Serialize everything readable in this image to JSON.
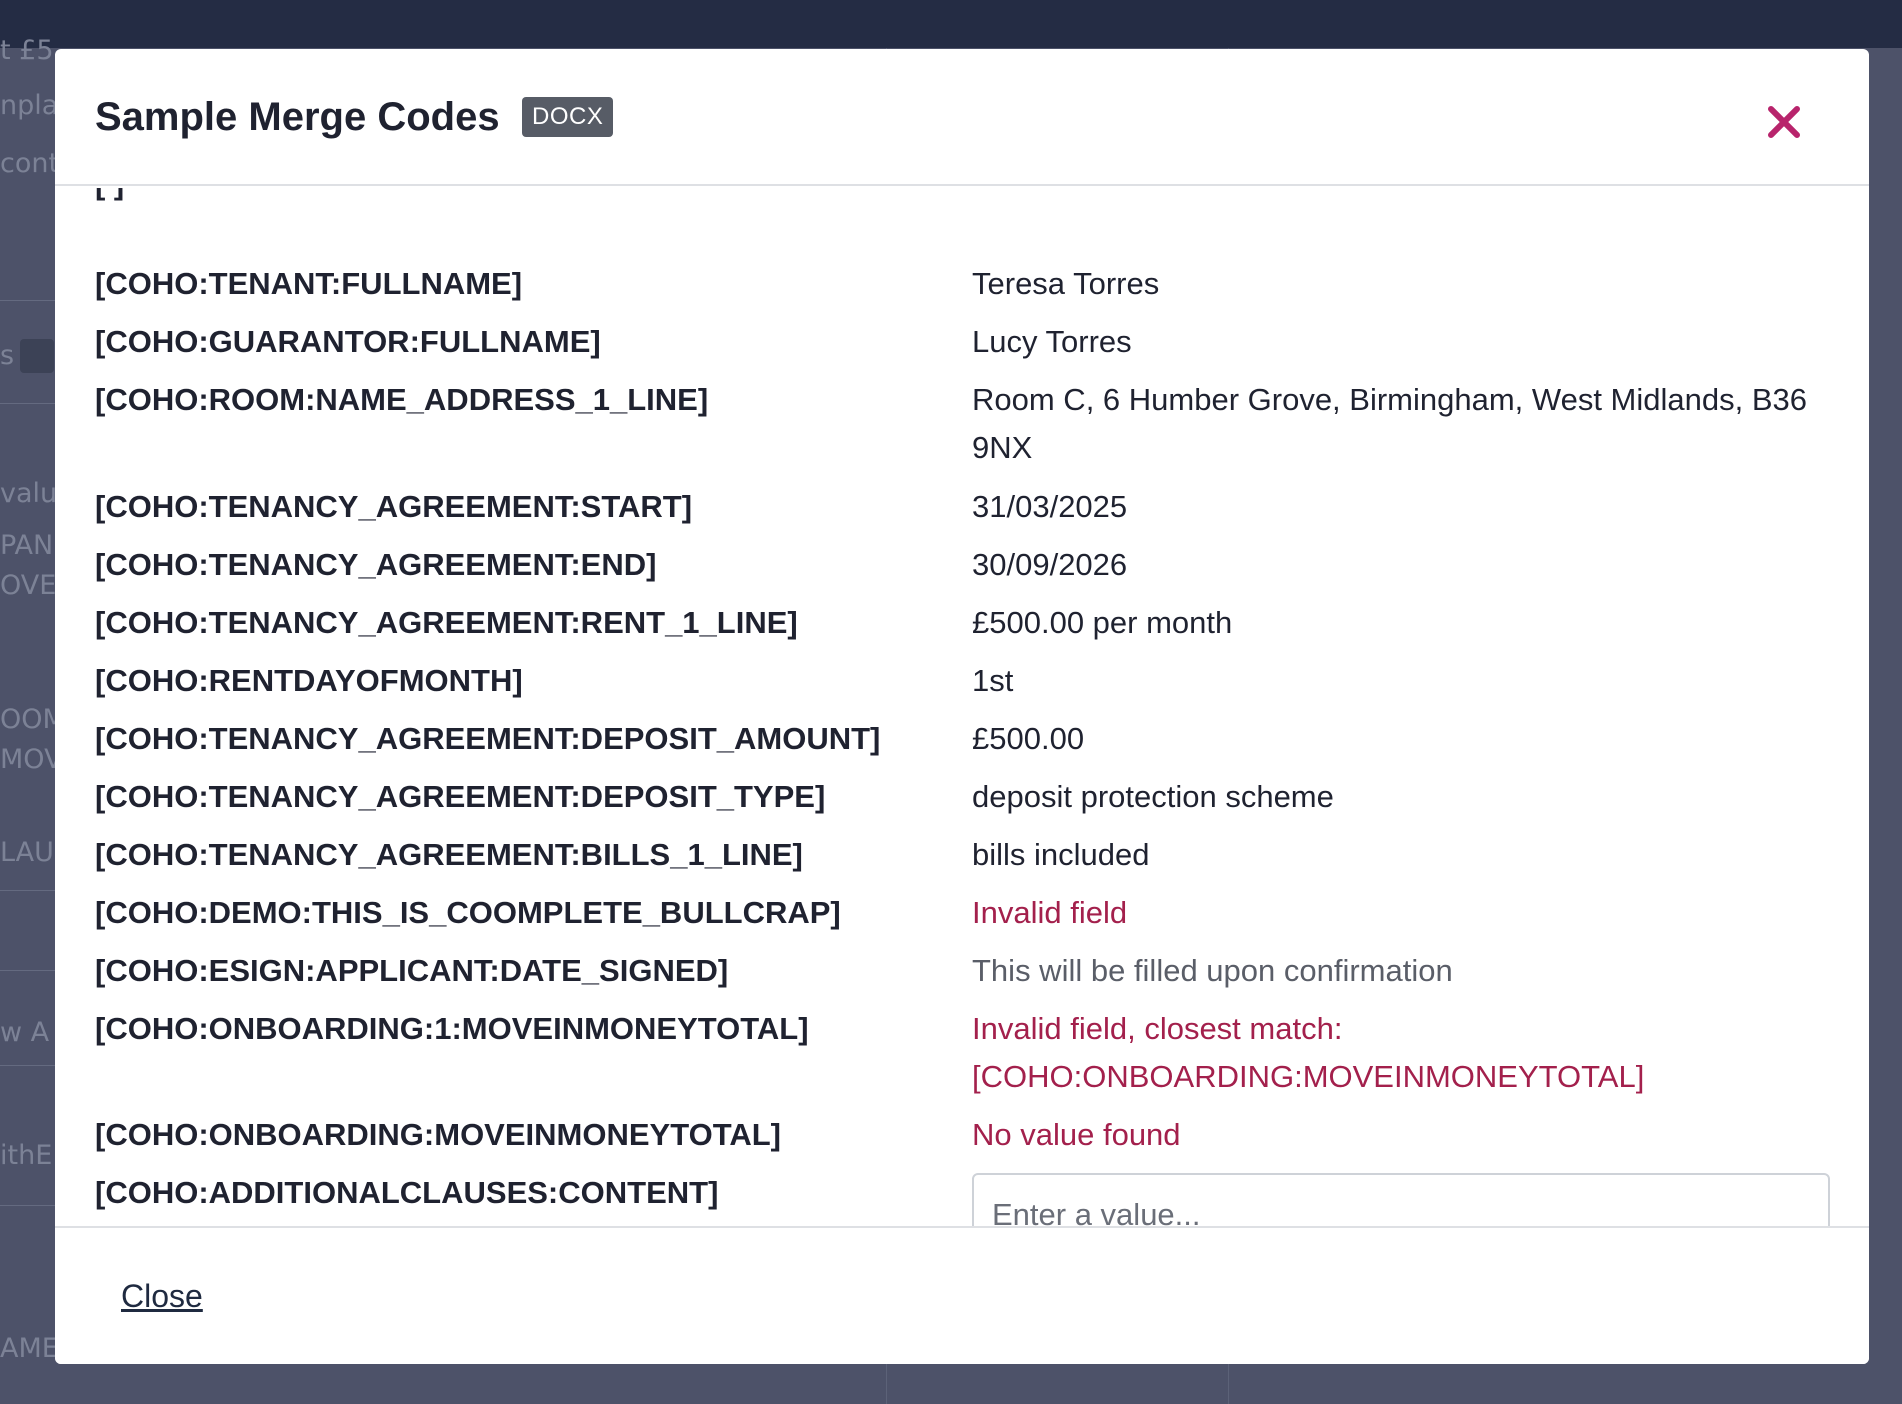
{
  "background": {
    "fragments": [
      "t £5",
      "npla",
      "cont",
      "s",
      "valu",
      "PAN",
      "OVE",
      "OOM",
      "MOV",
      "LAU",
      "w A",
      "ithE",
      "AME"
    ]
  },
  "modal": {
    "title": "Sample Merge Codes",
    "badge": "DOCX",
    "close_icon": "close-icon",
    "rows": [
      {
        "code": "[COHO:TENANT:FULLNAME]",
        "value": "Teresa Torres",
        "status": "ok"
      },
      {
        "code": "[COHO:GUARANTOR:FULLNAME]",
        "value": "Lucy Torres",
        "status": "ok"
      },
      {
        "code": "[COHO:ROOM:NAME_ADDRESS_1_LINE]",
        "value": "Room C, 6 Humber Grove, Birmingham, West Midlands, B36 9NX",
        "status": "ok"
      },
      {
        "code": "[COHO:TENANCY_AGREEMENT:START]",
        "value": "31/03/2025",
        "status": "ok"
      },
      {
        "code": "[COHO:TENANCY_AGREEMENT:END]",
        "value": "30/09/2026",
        "status": "ok"
      },
      {
        "code": "[COHO:TENANCY_AGREEMENT:RENT_1_LINE]",
        "value": "£500.00 per month",
        "status": "ok"
      },
      {
        "code": "[COHO:RENTDAYOFMONTH]",
        "value": "1st",
        "status": "ok"
      },
      {
        "code": "[COHO:TENANCY_AGREEMENT:DEPOSIT_AMOUNT]",
        "value": "£500.00",
        "status": "ok"
      },
      {
        "code": "[COHO:TENANCY_AGREEMENT:DEPOSIT_TYPE]",
        "value": "deposit protection scheme",
        "status": "ok"
      },
      {
        "code": "[COHO:TENANCY_AGREEMENT:BILLS_1_LINE]",
        "value": "bills included",
        "status": "ok"
      },
      {
        "code": "[COHO:DEMO:THIS_IS_COOMPLETE_BULLCRAP]",
        "value": "Invalid field",
        "status": "invalid"
      },
      {
        "code": "[COHO:ESIGN:APPLICANT:DATE_SIGNED]",
        "value": "This will be filled upon confirmation",
        "status": "pending"
      },
      {
        "code": "[COHO:ONBOARDING:1:MOVEINMONEYTOTAL]",
        "value": "Invalid field, closest match: [COHO:ONBOARDING:MOVEINMONEYTOTAL]",
        "status": "invalid"
      },
      {
        "code": "[COHO:ONBOARDING:MOVEINMONEYTOTAL]",
        "value": "No value found",
        "status": "invalid"
      },
      {
        "code": "[COHO:ADDITIONALCLAUSES:CONTENT]",
        "value": "",
        "placeholder": "Enter a value...",
        "status": "input"
      }
    ],
    "footer": {
      "close_label": "Close"
    }
  },
  "colors": {
    "invalid": "#a3204c",
    "close_icon": "#b8246c",
    "badge_bg": "#575c66",
    "overlay": "#4d5269",
    "topbar": "#242c44"
  }
}
